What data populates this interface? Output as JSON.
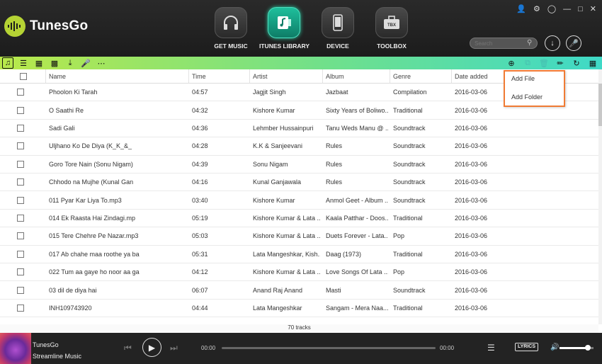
{
  "app": {
    "title": "TunesGo"
  },
  "nav": [
    {
      "label": "GET MUSIC",
      "icon": "headphones-icon"
    },
    {
      "label": "ITUNES LIBRARY",
      "icon": "itunes-library-icon",
      "active": true
    },
    {
      "label": "DEVICE",
      "icon": "phone-icon"
    },
    {
      "label": "TOOLBOX",
      "icon": "toolbox-icon",
      "badge": "TBX"
    }
  ],
  "search": {
    "placeholder": "Search"
  },
  "table": {
    "headers": [
      "Name",
      "Time",
      "Artist",
      "Album",
      "Genre",
      "Date added"
    ],
    "rows": [
      [
        "Phoolon Ki Tarah",
        "04:57",
        "Jagjit Singh",
        "Jazbaat",
        "Compilation",
        "2016-03-06"
      ],
      [
        "O Saathi  Re",
        "04:32",
        "Kishore Kumar",
        "Sixty Years of Boliwo...",
        "Traditional",
        "2016-03-06"
      ],
      [
        "Sadi Gali",
        "04:36",
        "Lehmber Hussainpuri",
        "Tanu Weds Manu @ ...",
        "Soundtrack",
        "2016-03-06"
      ],
      [
        "Uljhano Ko De Diya (K_K_&_",
        "04:28",
        "K.K & Sanjeevani",
        "Rules",
        "Soundtrack",
        "2016-03-06"
      ],
      [
        "Goro Tore Nain (Sonu Nigam)",
        "04:39",
        "Sonu Nigam",
        "Rules",
        "Soundtrack",
        "2016-03-06"
      ],
      [
        "Chhodo na Mujhe (Kunal Gan",
        "04:16",
        "Kunal Ganjawala",
        "Rules",
        "Soundtrack",
        "2016-03-06"
      ],
      [
        "011 Pyar Kar Liya To.mp3",
        "03:40",
        "Kishore Kumar",
        "Anmol Geet - Album ...",
        "Soundtrack",
        "2016-03-06"
      ],
      [
        "014  Ek Raasta Hai Zindagi.mp",
        "05:19",
        "Kishore Kumar & Lata ...",
        "Kaala Patthar - Doos...",
        "Traditional",
        "2016-03-06"
      ],
      [
        "015  Tere Chehre Pe Nazar.mp3",
        "05:03",
        "Kishore Kumar & Lata ...",
        "Duets Forever - Lata...",
        "Pop",
        "2016-03-06"
      ],
      [
        "017 Ab chahe maa roothe ya ba",
        "05:31",
        "Lata Mangeshkar, Kish...",
        "Daag (1973)",
        "Traditional",
        "2016-03-06"
      ],
      [
        "022 Tum aa gaye ho noor aa ga",
        "04:12",
        "Kishore Kumar & Lata ...",
        "Love Songs Of Lata ...",
        "Pop",
        "2016-03-06"
      ],
      [
        "03 dil de diya hai",
        "06:07",
        "Anand Raj Anand",
        "Masti",
        "Soundtrack",
        "2016-03-06"
      ],
      [
        "INH109743920",
        "04:44",
        "Lata Mangeshkar",
        "Sangam - Mera Naa...",
        "Traditional",
        "2016-03-06"
      ]
    ],
    "count_text": "70 tracks"
  },
  "dropdown": {
    "items": [
      "Add File",
      "Add Folder"
    ]
  },
  "player": {
    "title": "TunesGo",
    "subtitle": "Streamline Music",
    "elapsed": "00:00",
    "duration": "00:00",
    "lyrics_label": "LYRICS",
    "volume": 0.85
  },
  "colors": {
    "accent": "#f07b34",
    "toolbar_start": "#b9e84a",
    "toolbar_end": "#3fd9c7",
    "logo": "#b5d334"
  }
}
